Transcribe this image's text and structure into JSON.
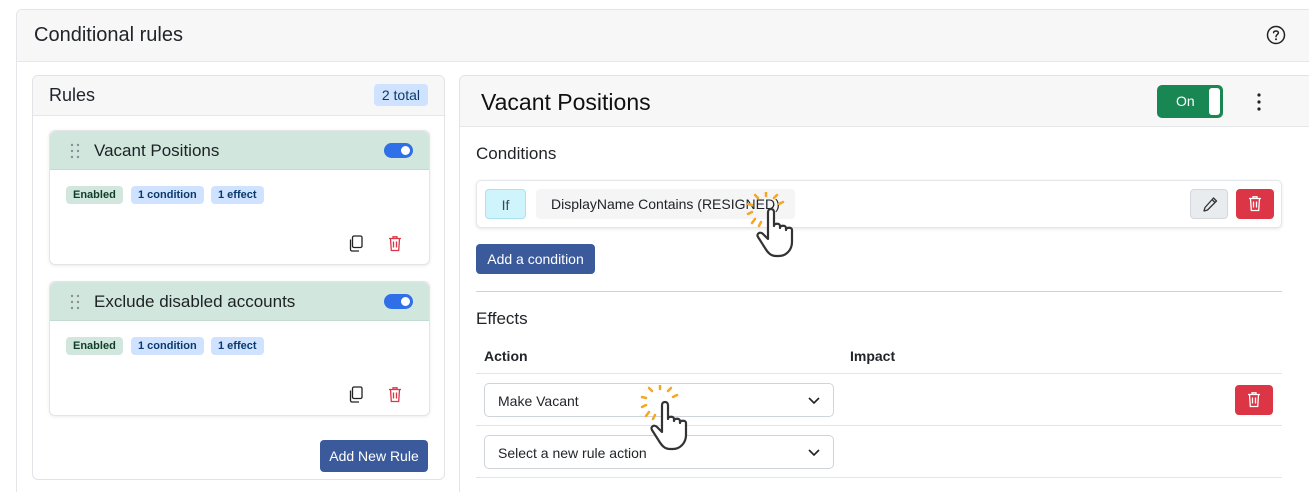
{
  "page": {
    "title": "Conditional rules"
  },
  "rules_panel": {
    "title": "Rules",
    "total_badge": "2 total",
    "add_button": "Add New Rule",
    "rules": [
      {
        "name": "Vacant Positions",
        "enabled": true,
        "tags": [
          "Enabled",
          "1 condition",
          "1 effect"
        ]
      },
      {
        "name": "Exclude disabled accounts",
        "enabled": true,
        "tags": [
          "Enabled",
          "1 condition",
          "1 effect"
        ]
      }
    ]
  },
  "detail": {
    "title": "Vacant Positions",
    "switch_label": "On",
    "conditions": {
      "heading": "Conditions",
      "items": [
        {
          "prefix": "If",
          "text": "DisplayName Contains (RESIGNED)"
        }
      ],
      "add_button": "Add a condition"
    },
    "effects": {
      "heading": "Effects",
      "columns": [
        "Action",
        "Impact"
      ],
      "rows": [
        {
          "action": "Make Vacant"
        }
      ],
      "new_action_placeholder": "Select a new rule action"
    }
  },
  "colors": {
    "primary_button": "#3a5a9b",
    "success": "#198754",
    "danger": "#dc3545",
    "rule_header": "#d1e7dd",
    "toggle": "#2f6fe8",
    "badge_blue": "#cfe2ff"
  },
  "icons": [
    "help-icon",
    "drag-handle-icon",
    "copy-icon",
    "trash-icon",
    "pencil-icon",
    "kebab-menu-icon",
    "chevron-down-icon",
    "hand-pointer-cursor-icon"
  ]
}
